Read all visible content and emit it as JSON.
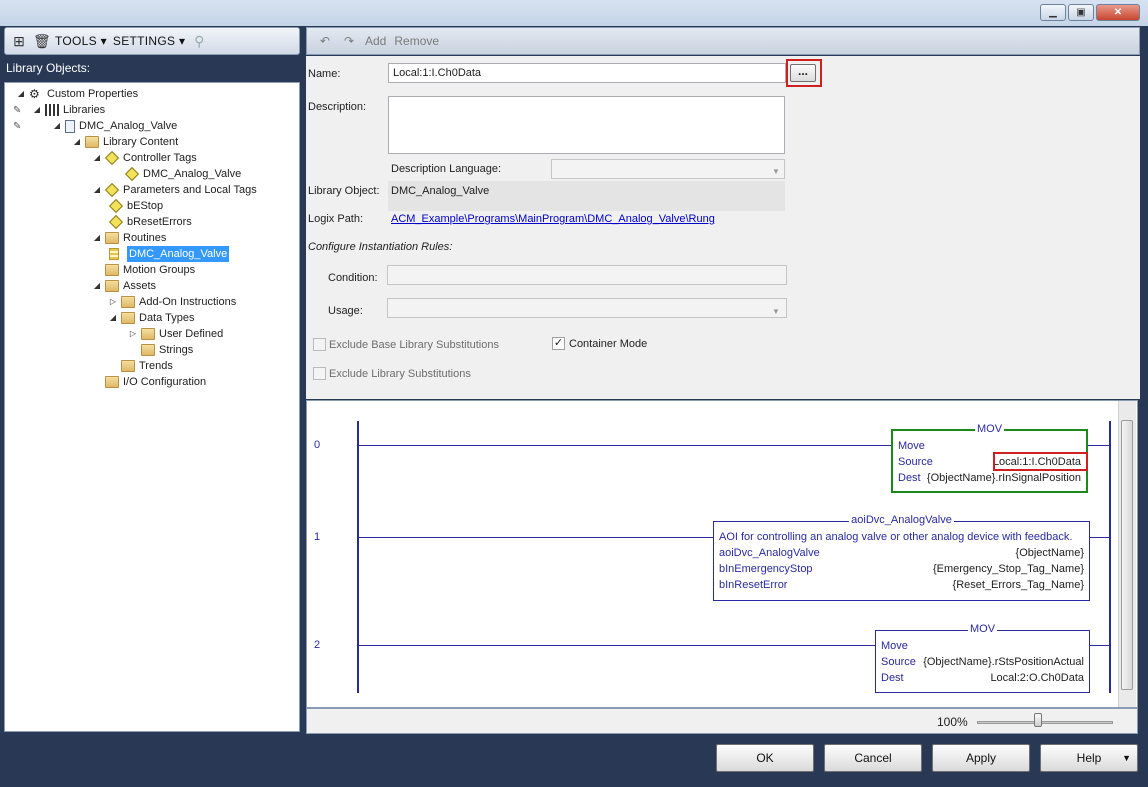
{
  "left": {
    "toolbar": {
      "tools_label": "TOOLS ▾",
      "settings_label": "SETTINGS ▾"
    },
    "panel_title": "Library Objects:",
    "tree": [
      {
        "label": "Custom Properties",
        "indent": 0
      },
      {
        "label": "Libraries",
        "indent": 0
      },
      {
        "label": "DMC_Analog_Valve",
        "indent": 1
      },
      {
        "label": "Library Content",
        "indent": 2
      },
      {
        "label": "Controller Tags",
        "indent": 3
      },
      {
        "label": "DMC_Analog_Valve",
        "indent": 4
      },
      {
        "label": "Parameters and Local Tags",
        "indent": 3
      },
      {
        "label": "bEStop",
        "indent": 4
      },
      {
        "label": "bResetErrors",
        "indent": 4
      },
      {
        "label": "Routines",
        "indent": 3
      },
      {
        "label": "DMC_Analog_Valve",
        "indent": 4
      },
      {
        "label": "Motion Groups",
        "indent": 3
      },
      {
        "label": "Assets",
        "indent": 3
      },
      {
        "label": "Add-On Instructions",
        "indent": 4
      },
      {
        "label": "Data Types",
        "indent": 4
      },
      {
        "label": "User Defined",
        "indent": 5
      },
      {
        "label": "Strings",
        "indent": 5
      },
      {
        "label": "Trends",
        "indent": 4
      },
      {
        "label": "I/O Configuration",
        "indent": 3
      }
    ]
  },
  "toolbar": {
    "add_label": "Add",
    "remove_label": "Remove"
  },
  "form": {
    "name_label": "Name:",
    "name_value": "Local:1:I.Ch0Data",
    "browse_label": "...",
    "description_label": "Description:",
    "description_value": "",
    "desc_language_label": "Description Language:",
    "desc_language_value": "",
    "library_object_label": "Library Object:",
    "library_object_value": "DMC_Analog_Valve",
    "logix_path_label": "Logix Path:",
    "logix_path_value": "ACM_Example\\Programs\\MainProgram\\DMC_Analog_Valve\\Rung",
    "instantiation_label": "Configure Instantiation Rules:",
    "condition_label": "Condition:",
    "usage_label": "Usage:",
    "exclude_base_label": "Exclude Base Library Substitutions",
    "exclude_base_checked": false,
    "container_mode_label": "Container Mode",
    "container_mode_checked": true,
    "exclude_lib_label": "Exclude Library Substitutions",
    "exclude_lib_checked": false
  },
  "ladder": {
    "rungs": [
      {
        "number": "0",
        "instruction": "MOV",
        "rows": [
          {
            "name": "Move",
            "value": ""
          },
          {
            "name": "Source",
            "value": "Local:1:I.Ch0Data"
          },
          {
            "name": "Dest",
            "value": "{ObjectName}.rInSignalPosition"
          }
        ]
      },
      {
        "number": "1",
        "instruction": "aoiDvc_AnalogValve",
        "rows": [
          {
            "name": "AOI for controlling an analog valve or other analog device with feedback.",
            "value": ""
          },
          {
            "name": "aoiDvc_AnalogValve",
            "value": "{ObjectName}"
          },
          {
            "name": "bInEmergencyStop",
            "value": "{Emergency_Stop_Tag_Name}"
          },
          {
            "name": "bInResetError",
            "value": "{Reset_Errors_Tag_Name}"
          }
        ]
      },
      {
        "number": "2",
        "instruction": "MOV",
        "rows": [
          {
            "name": "Move",
            "value": ""
          },
          {
            "name": "Source",
            "value": "{ObjectName}.rStsPositionActual"
          },
          {
            "name": "Dest",
            "value": "Local:2:O.Ch0Data"
          }
        ]
      }
    ]
  },
  "status": {
    "zoom_label": "100%",
    "zoom_fraction": 0.45
  },
  "buttons": {
    "ok": "OK",
    "cancel": "Cancel",
    "apply": "Apply",
    "help": "Help"
  },
  "icons": [
    "new-library-icon",
    "trash-icon",
    "undo-icon",
    "redo-icon",
    "gear-icon",
    "library-icon",
    "document-icon",
    "folder-icon",
    "tag-icon",
    "routine-icon",
    "pencil-icon",
    "checkmark-icon"
  ]
}
